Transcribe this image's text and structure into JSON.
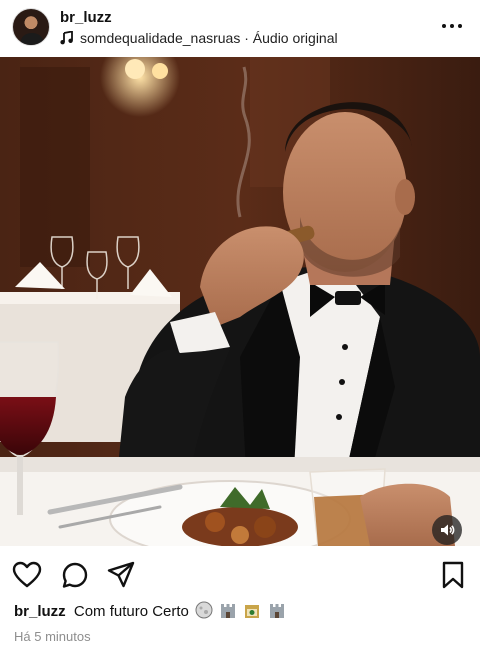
{
  "post": {
    "username": "br_luzz",
    "audio_label": "somdequalidade_nasruas · Áudio original",
    "caption_user": "br_luzz",
    "caption_text": "Com futuro Certo",
    "timestamp": "Há 5 minutos"
  },
  "icons": {
    "music": "music-note-icon",
    "more": "more-options-icon",
    "like": "heart-icon",
    "comment": "comment-icon",
    "share": "send-icon",
    "save": "bookmark-icon",
    "volume": "volume-icon"
  }
}
